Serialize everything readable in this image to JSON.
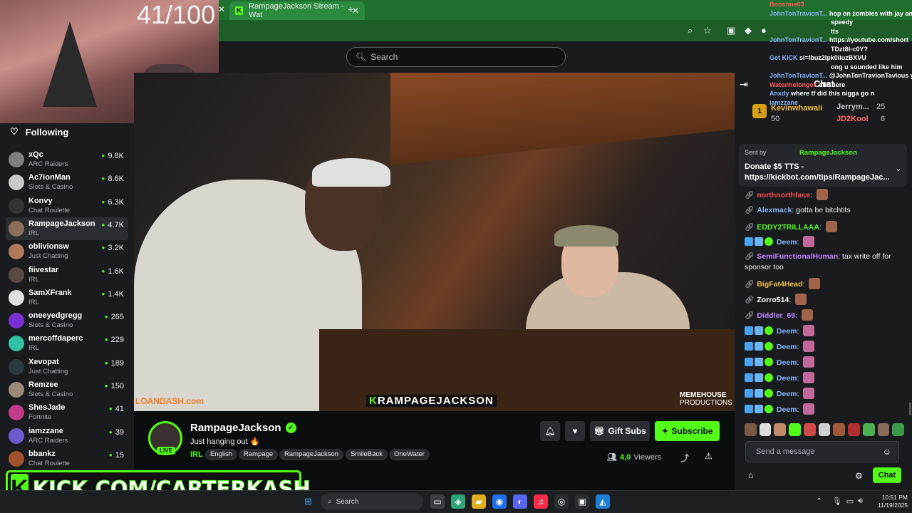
{
  "browser": {
    "tab_title": "RampageJackson Stream - Wat",
    "close_glyph": "✕",
    "new_tab_glyph": "+"
  },
  "webcam": {
    "counter": "41/100"
  },
  "nav": {
    "search_placeholder": "Search"
  },
  "sidebar": {
    "following_label": "Following",
    "channels": [
      {
        "name": "xQc",
        "category": "ARC Raiders",
        "viewers": "9.8K",
        "color": "#7d7f82"
      },
      {
        "name": "Ac7ionMan",
        "category": "Slots & Casino",
        "viewers": "8.6K",
        "color": "#c9c9c9"
      },
      {
        "name": "Konvy",
        "category": "Chat Roulette",
        "viewers": "6.3K",
        "color": "#333333"
      },
      {
        "name": "RampageJackson",
        "category": "IRL",
        "viewers": "4.7K",
        "color": "#8a6f5a"
      },
      {
        "name": "oblivionsw",
        "category": "Just Chatting",
        "viewers": "3.2K",
        "color": "#b07a5a"
      },
      {
        "name": "fiivestar",
        "category": "IRL",
        "viewers": "1.6K",
        "color": "#5a4a44"
      },
      {
        "name": "SamXFrank",
        "category": "IRL",
        "viewers": "1.4K",
        "color": "#e0e0e0"
      },
      {
        "name": "oneeyedgregg",
        "category": "Slots & Casino",
        "viewers": "265",
        "color": "#7a2fd1"
      },
      {
        "name": "mercoffdaperc",
        "category": "IRL",
        "viewers": "229",
        "color": "#2fc1a0"
      },
      {
        "name": "Xevopat",
        "category": "Just Chatting",
        "viewers": "189",
        "color": "#2b3a40"
      },
      {
        "name": "Remzee",
        "category": "Slots & Casino",
        "viewers": "150",
        "color": "#9a8a7a"
      },
      {
        "name": "ShesJade",
        "category": "Fortnite",
        "viewers": "41",
        "color": "#c23a8a"
      },
      {
        "name": "iamzzane",
        "category": "ARC Raiders",
        "viewers": "39",
        "color": "#6a5acd"
      },
      {
        "name": "bbankz",
        "category": "Chat Roulette",
        "viewers": "15",
        "color": "#a0522d"
      }
    ]
  },
  "video": {
    "sponsor": "LOANDASH.com",
    "watermark_k": "K",
    "watermark": "RAMPAGEJACKSON",
    "production_line1": "MEMEHOUSE",
    "production_line2": "PRODUCTIONS"
  },
  "streamer": {
    "name": "RampageJackson",
    "title": "Just hanging out 🔥",
    "live_label": "LIVE",
    "category": "IRL",
    "tags": [
      "English",
      "Rampage",
      "RampageJackson",
      "SmileBack",
      "OneWater"
    ],
    "gift_label": "Gift Subs",
    "subscribe_label": "Subscribe",
    "viewers_count": "4,0",
    "viewers_label": "Viewers"
  },
  "overlay": {
    "brand_text": "KICK.COM/CARTERKASH",
    "logo_letter": "K"
  },
  "taskbar": {
    "search_label": "Search",
    "time": "10:51 PM",
    "date": "11/19/2025"
  },
  "chat": {
    "title": "Chat",
    "leaderboard": [
      {
        "rank": "1",
        "name": "Kevinwhawaii",
        "count": "50"
      },
      {
        "name": "Jerrym...",
        "count": "25"
      },
      {
        "name": "JD2Kool",
        "count": "6"
      }
    ],
    "pinned": {
      "sent_by": "Sent by",
      "sender": "RampageJackson",
      "message": "Donate $5 TTS - https://kickbot.com/tips/RampageJac..."
    },
    "messages": [
      {
        "user": "northnorthface",
        "text": "",
        "color": "#ff4d4d"
      },
      {
        "user": "Alexmack",
        "text": "gotta be bitchtits",
        "color": "#8ab4f8"
      },
      {
        "user": "EDDY2TRILLAAA",
        "text": "",
        "color": "#53fc18"
      },
      {
        "user": "Deem",
        "text": "",
        "color": "#8ab4f8"
      },
      {
        "user": "SemiFunctionalHuman",
        "text": "tax write off for sponsor too",
        "color": "#c084fc"
      },
      {
        "user": "BigFat4Head",
        "text": "",
        "color": "#f0c040"
      },
      {
        "user": "Zorro514",
        "text": "",
        "color": "#ffffff"
      },
      {
        "user": "Diddler_69",
        "text": "",
        "color": "#c084fc"
      },
      {
        "user": "Deem",
        "text": "",
        "color": "#8ab4f8"
      },
      {
        "user": "Deem",
        "text": "",
        "color": "#8ab4f8"
      },
      {
        "user": "Deem",
        "text": "",
        "color": "#8ab4f8"
      },
      {
        "user": "Deem",
        "text": "",
        "color": "#8ab4f8"
      },
      {
        "user": "Deem",
        "text": "",
        "color": "#8ab4f8"
      },
      {
        "user": "Deem",
        "text": "",
        "color": "#8ab4f8"
      }
    ],
    "input_placeholder": "Send a message",
    "send_label": "Chat"
  },
  "tts_overlay": {
    "lines": [
      {
        "user": "Boostme03",
        "text": ""
      },
      {
        "user": "JohnTonTravionT...",
        "text": "hop on zombies with jay and"
      },
      {
        "user": "",
        "text": "speedy"
      },
      {
        "user": "",
        "text": "tts"
      },
      {
        "user": "JohnTonTravionT...",
        "text": "https://youtube.com/short"
      },
      {
        "user": "",
        "text": "TDzt8t-c0Y?"
      },
      {
        "user": "Get KICK",
        "text": "si=lbuz2lpk0iiuzBXVU"
      },
      {
        "user": "",
        "text": "ong u sounded like him"
      },
      {
        "user": "JohnTonTravionT...",
        "text": "@JohnTonTravionTavious y"
      },
      {
        "user": "Watermelonges",
        "text": "still here"
      },
      {
        "user": "Anxdy",
        "text": "where tf did this nigga go n"
      },
      {
        "user": "iamzzane",
        "text": ""
      }
    ]
  },
  "colors": {
    "accent": "#53fc18",
    "background": "#0b0e0f",
    "panel": "#191b1f"
  }
}
